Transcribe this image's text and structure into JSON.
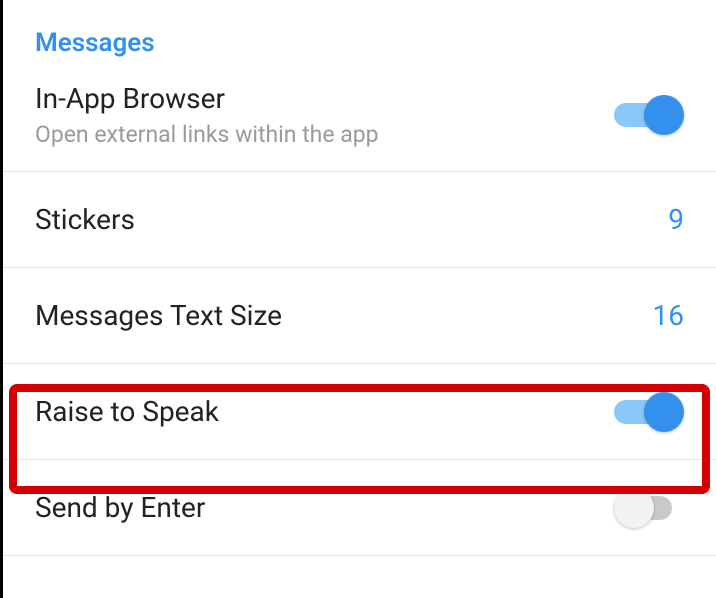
{
  "section": {
    "title": "Messages"
  },
  "rows": {
    "inAppBrowser": {
      "title": "In-App Browser",
      "subtitle": "Open external links within the app",
      "enabled": true
    },
    "stickers": {
      "title": "Stickers",
      "value": "9"
    },
    "textSize": {
      "title": "Messages Text Size",
      "value": "16"
    },
    "raiseToSpeak": {
      "title": "Raise to Speak",
      "enabled": true
    },
    "sendByEnter": {
      "title": "Send by Enter",
      "enabled": false
    }
  }
}
